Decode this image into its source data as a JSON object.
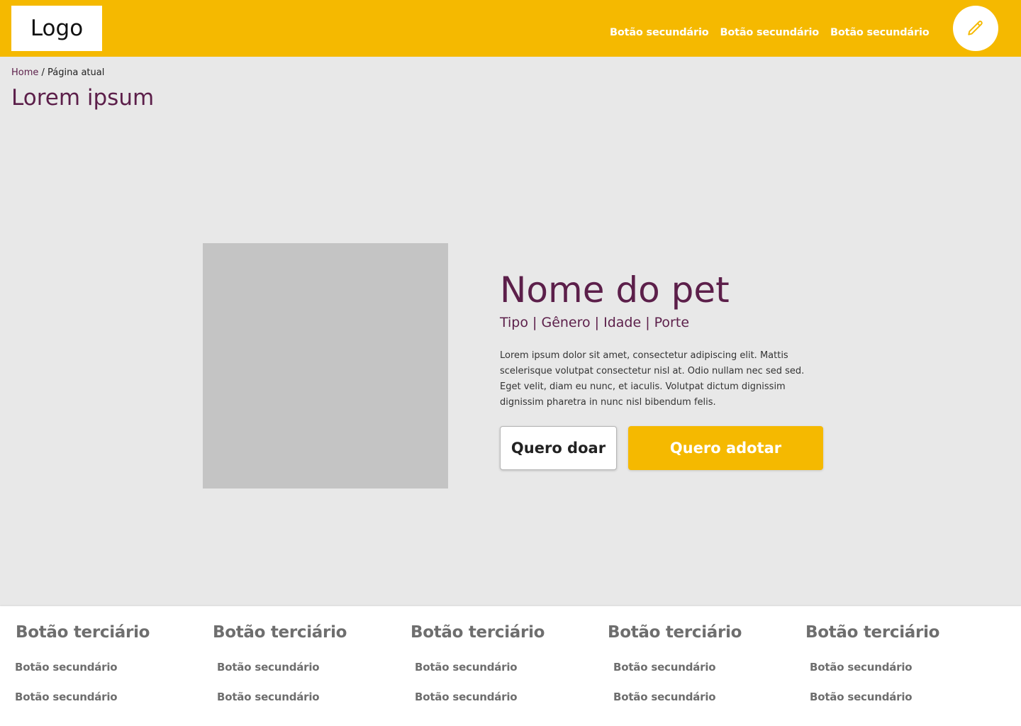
{
  "header": {
    "logo": "Logo",
    "nav": [
      "Botão secundário",
      "Botão secundário",
      "Botão secundário"
    ],
    "edit_icon": "pencil-icon",
    "bg_color": "#f5b900"
  },
  "breadcrumb": {
    "home": "Home",
    "separator": " / ",
    "current": "Página atual"
  },
  "page": {
    "title": "Lorem ipsum"
  },
  "pet": {
    "name": "Nome do pet",
    "meta": "Tipo | Gênero | Idade | Porte",
    "description": "Lorem ipsum dolor sit amet, consectetur adipiscing elit. Mattis scelerisque volutpat consectetur nisl at. Odio nullam nec sed sed. Eget velit, diam eu nunc, et iaculis. Volutpat dictum dignissim dignissim pharetra in nunc nisl bibendum felis.",
    "donate_label": "Quero doar",
    "adopt_label": "Quero adotar"
  },
  "footer": {
    "columns": [
      {
        "heading": "Botão terciário",
        "links": [
          "Botão secundário",
          "Botão secundário"
        ]
      },
      {
        "heading": "Botão terciário",
        "links": [
          "Botão secundário",
          "Botão secundário"
        ]
      },
      {
        "heading": "Botão terciário",
        "links": [
          "Botão secundário",
          "Botão secundário"
        ]
      },
      {
        "heading": "Botão terciário",
        "links": [
          "Botão secundário",
          "Botão secundário"
        ]
      },
      {
        "heading": "Botão terciário",
        "links": [
          "Botão secundário",
          "Botão secundário"
        ]
      }
    ]
  },
  "colors": {
    "accent": "#f5b900",
    "brand": "#5c1f4a",
    "background": "#e8e8e8"
  }
}
